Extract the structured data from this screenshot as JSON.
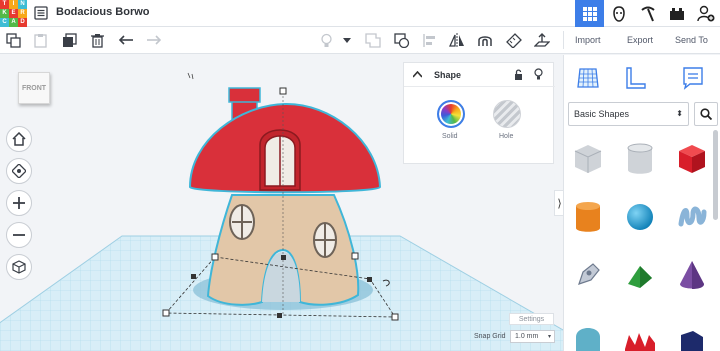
{
  "app": {
    "logo_letters": [
      "T",
      "I",
      "N",
      "K",
      "E",
      "R",
      "C",
      "A",
      "D"
    ],
    "logo_colors": [
      "#e73a2f",
      "#f7a81b",
      "#3ebdd4",
      "#54b948",
      "#e73a2f",
      "#f7a81b",
      "#3ebdd4",
      "#54b948",
      "#e73a2f"
    ],
    "design_title": "Bodacious Borwo"
  },
  "topnav": {
    "icons": [
      "grid-view-icon",
      "gallery-icon",
      "pickaxe-icon",
      "bricks-icon",
      "user-add-icon"
    ],
    "active": "grid-view-icon"
  },
  "toolbar": {
    "import_label": "Import",
    "export_label": "Export",
    "send_to_label": "Send To"
  },
  "viewcube": {
    "label": "FRONT"
  },
  "shape_panel": {
    "title": "Shape",
    "solid_label": "Solid",
    "hole_label": "Hole"
  },
  "canvas": {
    "settings_label": "Settings",
    "snap_grid_label": "Snap Grid",
    "snap_grid_value": "1.0 mm"
  },
  "library": {
    "category": "Basic Shapes",
    "shapes": [
      {
        "name": "box-hole-icon",
        "color": "#b9bec6"
      },
      {
        "name": "cylinder-hole-icon",
        "color": "#b9bec6"
      },
      {
        "name": "box-icon",
        "color": "#d81e2a"
      },
      {
        "name": "cylinder-icon",
        "color": "#e8821e"
      },
      {
        "name": "sphere-icon",
        "color": "#1aa0d8"
      },
      {
        "name": "scribble-icon",
        "color": "#8ab4d8"
      },
      {
        "name": "pen-icon",
        "color": "#a9b3c4"
      },
      {
        "name": "roof-icon",
        "color": "#2f9e3e"
      },
      {
        "name": "cone-icon",
        "color": "#7b4ea3"
      }
    ]
  },
  "colors": {
    "accent": "#3d7ee8",
    "roof": "#d9303a",
    "house_body": "#e2c7a8",
    "selection": "#3fb6d8"
  }
}
